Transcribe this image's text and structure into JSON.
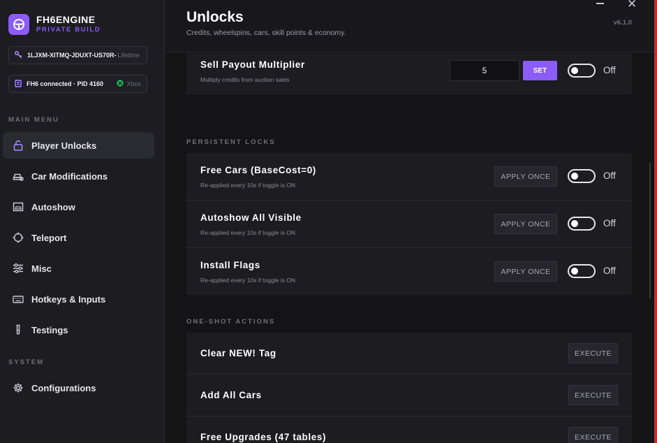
{
  "brand": {
    "name": "FH6ENGINE",
    "subtitle": "PRIVATE BUILD",
    "accent": "#8b5cf6"
  },
  "license": {
    "key": "1LJXM-XITMQ-JDUXT-US70R-",
    "tier": "Lifetime"
  },
  "status": {
    "text": "FH6 connected · PID 4160",
    "platform": "Xbox"
  },
  "sidebar": {
    "main_label": "MAIN MENU",
    "system_label": "SYSTEM",
    "items": [
      {
        "label": "Player Unlocks",
        "icon": "lock-open-icon",
        "active": true
      },
      {
        "label": "Car Modifications",
        "icon": "car-icon"
      },
      {
        "label": "Autoshow",
        "icon": "autoshow-icon"
      },
      {
        "label": "Teleport",
        "icon": "crosshair-icon"
      },
      {
        "label": "Misc",
        "icon": "sliders-icon"
      },
      {
        "label": "Hotkeys & Inputs",
        "icon": "keyboard-icon"
      },
      {
        "label": "Testings",
        "icon": "test-tube-icon"
      }
    ],
    "system_items": [
      {
        "label": "Configurations",
        "icon": "gear-icon"
      }
    ]
  },
  "header": {
    "title": "Unlocks",
    "subtitle": "Credits, wheelspins, cars, skill points & economy.",
    "version": "v6.1.0"
  },
  "sell_payout": {
    "title": "Sell Payout Multiplier",
    "desc": "Multiply credits from auction sales",
    "value": "5",
    "set_label": "SET",
    "toggle_label": "Off"
  },
  "persistent": {
    "label": "PERSISTENT LOCKS",
    "items": [
      {
        "title": "Free Cars (BaseCost=0)",
        "desc": "Re-applied every 10s if toggle is ON",
        "button": "APPLY ONCE",
        "toggle_label": "Off"
      },
      {
        "title": "Autoshow All Visible",
        "desc": "Re-applied every 10s if toggle is ON",
        "button": "APPLY ONCE",
        "toggle_label": "Off"
      },
      {
        "title": "Install Flags",
        "desc": "Re-applied every 10s if toggle is ON",
        "button": "APPLY ONCE",
        "toggle_label": "Off"
      }
    ]
  },
  "oneshot": {
    "label": "ONE-SHOT ACTIONS",
    "items": [
      {
        "title": "Clear NEW! Tag",
        "button": "EXECUTE"
      },
      {
        "title": "Add All Cars",
        "button": "EXECUTE"
      },
      {
        "title": "Free Upgrades (47 tables)",
        "button": "EXECUTE"
      }
    ]
  }
}
